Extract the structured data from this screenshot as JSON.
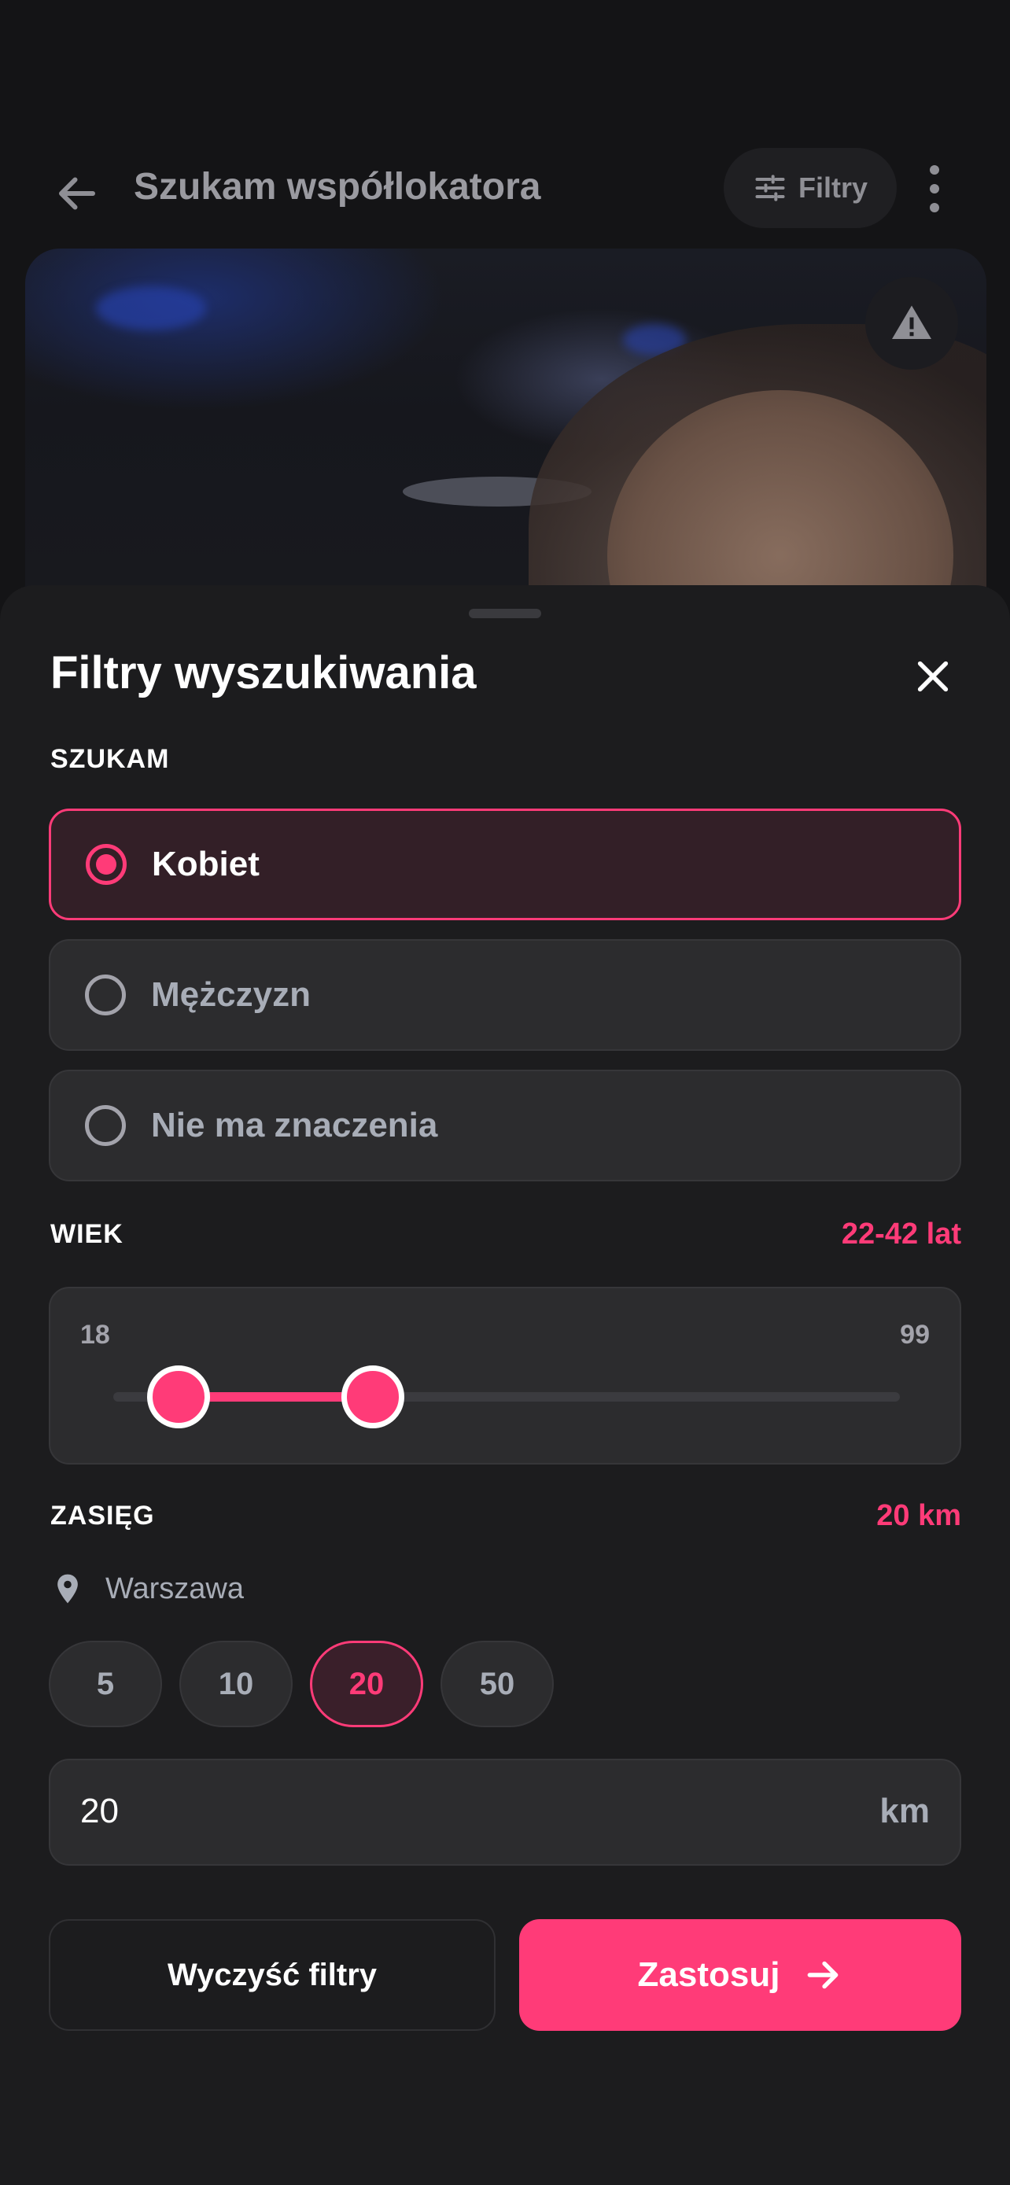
{
  "background": {
    "header_title": "Szukam współlokatora",
    "filters_button_label": "Filtry",
    "icons": {
      "back": "arrow-left-icon",
      "filters": "sliders-icon",
      "more": "more-vertical-icon",
      "report": "warning-icon"
    }
  },
  "sheet": {
    "title": "Filtry wyszukiwania",
    "close_icon": "close-icon",
    "looking_for": {
      "label": "SZUKAM",
      "options": [
        {
          "label": "Kobiet",
          "selected": true
        },
        {
          "label": "Mężczyzn",
          "selected": false
        },
        {
          "label": "Nie ma znaczenia",
          "selected": false
        }
      ]
    },
    "age": {
      "label": "WIEK",
      "value_text": "22-42 lat",
      "min_label": "18",
      "max_label": "99",
      "range_min": 18,
      "range_max": 99,
      "selected_min": 22,
      "selected_max": 42
    },
    "range": {
      "label": "ZASIĘG",
      "value_text": "20 km",
      "location_icon": "map-pin-icon",
      "location": "Warszawa",
      "chips": [
        {
          "label": "5",
          "active": false
        },
        {
          "label": "10",
          "active": false
        },
        {
          "label": "20",
          "active": true
        },
        {
          "label": "50",
          "active": false
        }
      ],
      "input_value": "20",
      "input_unit": "km"
    },
    "buttons": {
      "clear": "Wyczyść filtry",
      "apply": "Zastosuj",
      "apply_icon": "arrow-right-icon"
    }
  },
  "colors": {
    "accent": "#ff3b78",
    "sheet_bg": "#1c1c1e",
    "card_bg": "#2c2c2e"
  }
}
